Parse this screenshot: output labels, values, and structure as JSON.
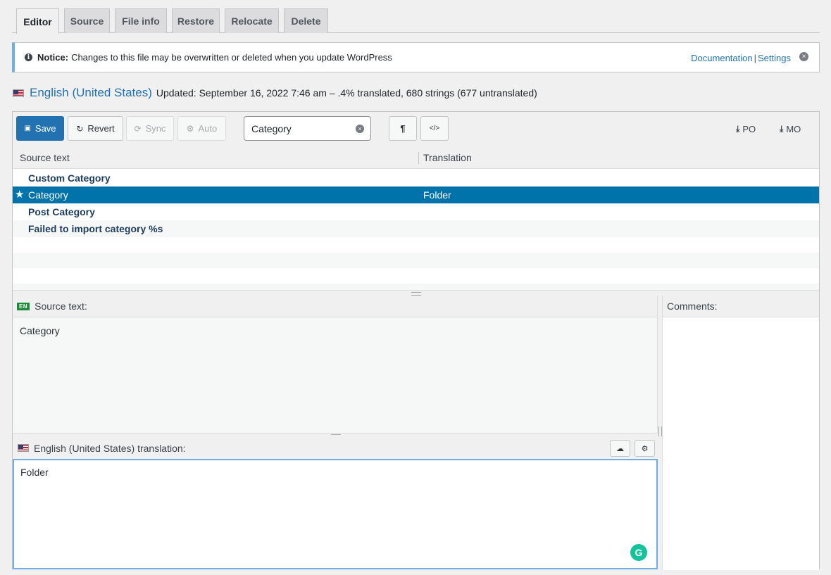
{
  "tabs": [
    {
      "label": "Editor",
      "active": true
    },
    {
      "label": "Source",
      "active": false
    },
    {
      "label": "File info",
      "active": false
    },
    {
      "label": "Restore",
      "active": false
    },
    {
      "label": "Relocate",
      "active": false
    },
    {
      "label": "Delete",
      "active": false
    }
  ],
  "notice": {
    "lead": "Notice:",
    "message": "Changes to this file may be overwritten or deleted when you update WordPress",
    "link_documentation": "Documentation",
    "separator": "|",
    "link_settings": "Settings",
    "info_icon": "i",
    "dismiss_icon": "×"
  },
  "locale": {
    "language": "English (United States)",
    "meta": "Updated: September 16, 2022 7:46 am – .4% translated, 680 strings (677 untranslated)"
  },
  "toolbar": {
    "save_label": "Save",
    "revert_label": "Revert",
    "sync_label": "Sync",
    "auto_label": "Auto",
    "search_value": "Category",
    "search_clear_icon": "×",
    "pilcrow_icon": "¶",
    "code_icon": "</>",
    "po_label": "PO",
    "mo_label": "MO",
    "download_icon": "⤓",
    "save_icon": "💾",
    "revert_icon": "↻",
    "sync_icon": "⟳",
    "auto_icon": "⚙"
  },
  "grid": {
    "header_source": "Source text",
    "header_translation": "Translation",
    "rows": [
      {
        "source": "Custom Category",
        "translation": ""
      },
      {
        "source": "Category",
        "translation": "Folder"
      },
      {
        "source": "Post Category",
        "translation": ""
      },
      {
        "source": "Failed to import category %s",
        "translation": ""
      }
    ],
    "selected_star": "★"
  },
  "source_pane": {
    "badge": "EN",
    "label": "Source text:",
    "text": "Category"
  },
  "translation_pane": {
    "label": "English (United States) translation:",
    "value": "Folder",
    "cloud_icon": "☁",
    "robot_icon": "⚙",
    "grammarly_icon": "G"
  },
  "comments": {
    "label": "Comments:"
  },
  "colors": {
    "accent": "#2271b1",
    "selected_row": "#0073aa",
    "grammarly": "#15c39a"
  }
}
